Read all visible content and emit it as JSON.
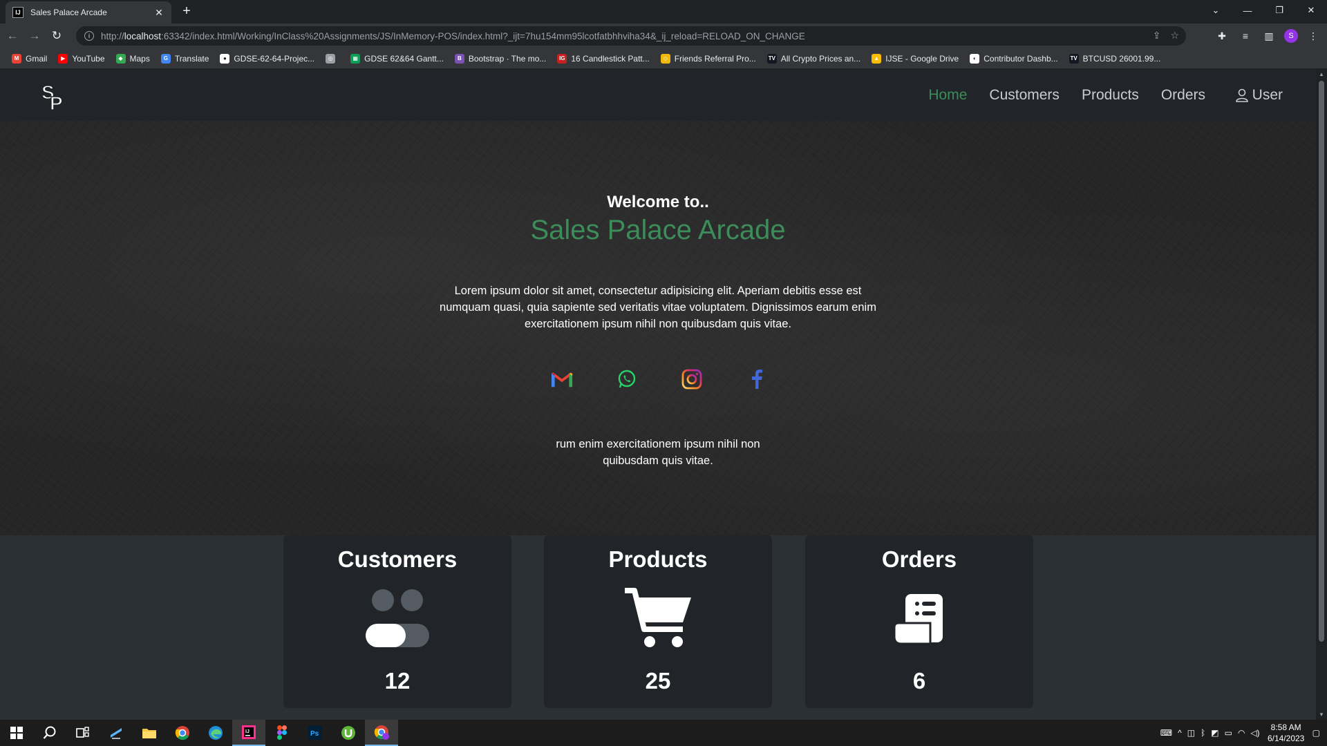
{
  "browser": {
    "tab_title": "Sales Palace Arcade",
    "url_prefix": "http://",
    "url_host": "localhost",
    "url_rest": ":63342/index.html/Working/InClass%20Assignments/JS/InMemory-POS/index.html?_ijt=7hu154mm95lcotfatbhhviha34&_ij_reload=RELOAD_ON_CHANGE",
    "avatar_letter": "S",
    "bookmarks": [
      {
        "label": "Gmail",
        "color": "#ea4335",
        "glyph": "M"
      },
      {
        "label": "YouTube",
        "color": "#ff0000",
        "glyph": "▶"
      },
      {
        "label": "Maps",
        "color": "#34a853",
        "glyph": "◆"
      },
      {
        "label": "Translate",
        "color": "#4285f4",
        "glyph": "G"
      },
      {
        "label": "GDSE-62-64-Projec...",
        "color": "#ffffff",
        "glyph": "●"
      },
      {
        "label": "",
        "color": "#9aa0a6",
        "glyph": "◎"
      },
      {
        "label": "GDSE 62&64 Gantt...",
        "color": "#0f9d58",
        "glyph": "▦"
      },
      {
        "label": "Bootstrap · The mo...",
        "color": "#7952b3",
        "glyph": "B"
      },
      {
        "label": "16 Candlestick Patt...",
        "color": "#c5221f",
        "glyph": "IG"
      },
      {
        "label": "Friends Referral Pro...",
        "color": "#f0b90b",
        "glyph": "◇"
      },
      {
        "label": "All Crypto Prices an...",
        "color": "#131722",
        "glyph": "TV"
      },
      {
        "label": "IJSE - Google Drive",
        "color": "#fbbc04",
        "glyph": "▲"
      },
      {
        "label": "Contributor Dashb...",
        "color": "#ffffff",
        "glyph": "◐"
      },
      {
        "label": "BTCUSD 26001.99...",
        "color": "#131722",
        "glyph": "TV"
      }
    ]
  },
  "nav": {
    "links": [
      "Home",
      "Customers",
      "Products",
      "Orders"
    ],
    "user_label": "User"
  },
  "hero": {
    "welcome": "Welcome to..",
    "title": "Sales Palace Arcade",
    "text": "Lorem ipsum dolor sit amet, consectetur adipisicing elit. Aperiam debitis esse est numquam quasi, quia sapiente sed veritatis vitae voluptatem. Dignissimos earum enim exercitationem ipsum nihil non quibusdam quis vitae.",
    "footer_text": "rum enim exercitationem ipsum nihil non quibusdam quis vitae.",
    "socials": [
      "gmail-icon",
      "whatsapp-icon",
      "instagram-icon",
      "facebook-icon"
    ]
  },
  "cards": [
    {
      "title": "Customers",
      "value": "12",
      "icon": "users-toggle-icon"
    },
    {
      "title": "Products",
      "value": "25",
      "icon": "cart-icon"
    },
    {
      "title": "Orders",
      "value": "6",
      "icon": "receipt-icon"
    }
  ],
  "taskbar": {
    "time": "8:58 AM",
    "date": "6/14/2023"
  },
  "colors": {
    "accent_green": "#3c8d5a",
    "nav_bg": "#212529",
    "card_bg": "#212529"
  }
}
